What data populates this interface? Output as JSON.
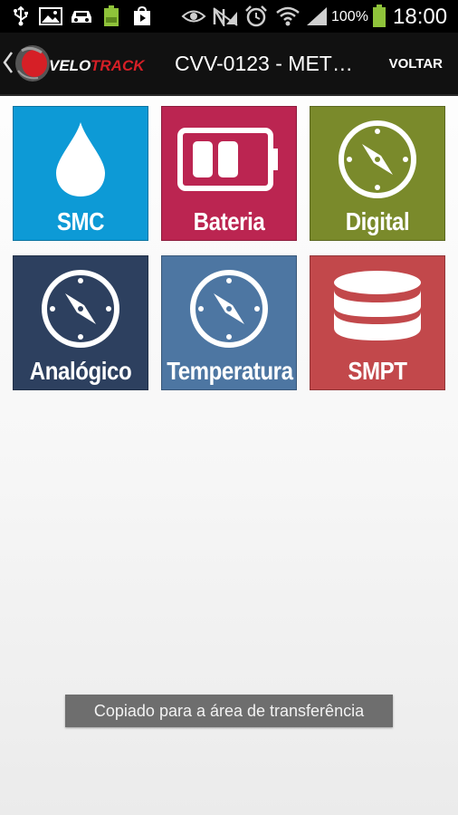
{
  "status_bar": {
    "battery_percent": "100%",
    "time": "18:00",
    "icons": [
      "usb-icon",
      "image-icon",
      "car-icon",
      "battery-full-icon",
      "play-store-icon",
      "eye-icon",
      "no-signal-icon",
      "alarm-icon",
      "wifi-icon",
      "signal-icon",
      "battery-icon"
    ]
  },
  "action_bar": {
    "title": "CVV-0123 - MET…",
    "action_label": "VOLTAR",
    "logo_text": "VELOTRACK"
  },
  "tiles": [
    {
      "label": "SMC",
      "icon": "drop-icon",
      "color": "#0d9ad6"
    },
    {
      "label": "Bateria",
      "icon": "battery-icon",
      "color": "#bb2551"
    },
    {
      "label": "Digital",
      "icon": "compass-icon",
      "color": "#7a8a2b"
    },
    {
      "label": "Analógico",
      "icon": "compass-icon",
      "color": "#2d405f"
    },
    {
      "label": "Temperatura",
      "icon": "compass-icon",
      "color": "#4d76a2"
    },
    {
      "label": "SMPT",
      "icon": "database-icon",
      "color": "#c2484b"
    }
  ],
  "toast": {
    "message": "Copiado para a área de transferência"
  }
}
